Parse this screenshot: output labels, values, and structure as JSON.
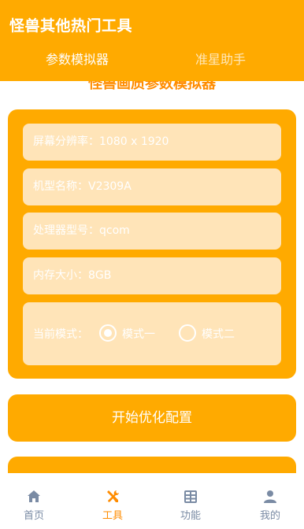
{
  "header": {
    "title": "怪兽其他热门工具",
    "tabs": [
      "参数模拟器",
      "准星助手"
    ]
  },
  "section_heading": "怪兽画质参数模拟器",
  "form": {
    "resolution": {
      "label": "屏幕分辨率：",
      "value": "1080 x 1920"
    },
    "model": {
      "label": "机型名称：",
      "value": "V2309A"
    },
    "processor": {
      "label": "处理器型号：",
      "value": "qcom"
    },
    "memory": {
      "label": "内存大小：",
      "value": "8GB"
    },
    "mode": {
      "label": "当前模式：",
      "options": [
        "模式一",
        "模式二"
      ],
      "selected": "模式一"
    }
  },
  "primary_button": "开始优化配置",
  "bottom_nav": {
    "items": [
      {
        "label": "首页",
        "icon": "home-icon"
      },
      {
        "label": "工具",
        "icon": "tools-icon"
      },
      {
        "label": "功能",
        "icon": "grid-icon"
      },
      {
        "label": "我的",
        "icon": "user-icon"
      }
    ],
    "active": "工具"
  },
  "colors": {
    "accent": "#FFAA00",
    "field_bg": "#FFE4B8",
    "active_nav": "#FF8C00",
    "inactive_nav": "#7A8BA4"
  }
}
